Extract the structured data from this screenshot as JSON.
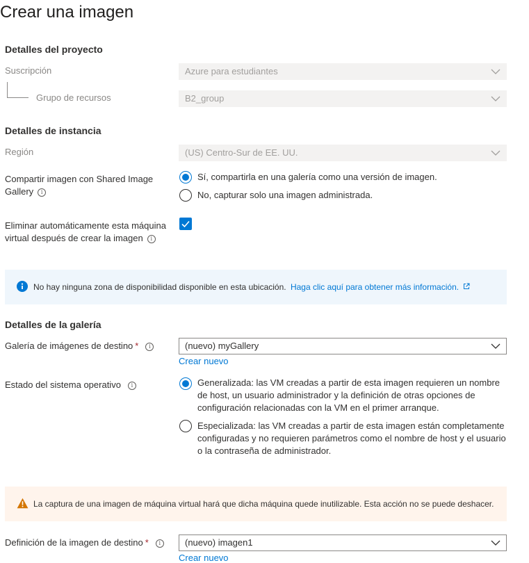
{
  "page": {
    "title": "Crear una imagen"
  },
  "project": {
    "title": "Detalles del proyecto",
    "subscription_label": "Suscripción",
    "subscription_value": "Azure para estudiantes",
    "resource_group_label": "Grupo de recursos",
    "resource_group_value": "B2_group"
  },
  "instance": {
    "title": "Detalles de instancia",
    "region_label": "Región",
    "region_value": "(US) Centro-Sur de EE. UU.",
    "share_label_1": "Compartir imagen con Shared Image",
    "share_label_2": "Gallery",
    "share_yes": "Sí, compartirla en una galería como una versión de imagen.",
    "share_no": "No, capturar solo una imagen administrada.",
    "share_selected": "yes",
    "delete_label_1": "Eliminar automáticamente esta máquina",
    "delete_label_2": "virtual después de crear la imagen",
    "delete_checked": true
  },
  "info_bar": {
    "text": "No hay ninguna zona de disponibilidad disponible en esta ubicación.",
    "link": "Haga clic aquí para obtener más información."
  },
  "gallery": {
    "title": "Detalles de la galería",
    "target_gallery_label": "Galería de imágenes de destino",
    "target_gallery_value": "(nuevo) myGallery",
    "create_new": "Crear nuevo",
    "os_state_label": "Estado del sistema operativo",
    "generalized": [
      "Generalizada: las VM creadas a partir de esta imagen requieren un nombre",
      "de host, un usuario administrador y la definición de otras opciones de",
      "configuración relacionadas con la VM en el primer arranque."
    ],
    "specialized": [
      "Especializada: las VM creadas a partir de esta imagen están completamente",
      "configuradas y no requieren parámetros como el nombre de host y el usuario",
      "o la contraseña de administrador."
    ],
    "os_state_selected": "generalized"
  },
  "warn_bar": {
    "text": "La captura de una imagen de máquina virtual hará que dicha máquina quede inutilizable. Esta acción no se puede deshacer."
  },
  "definition": {
    "label": "Definición de la imagen de destino",
    "value": "(nuevo) imagen1",
    "create_new": "Crear nuevo"
  },
  "colors": {
    "accent": "#0078d4",
    "warning": "#d47500"
  }
}
